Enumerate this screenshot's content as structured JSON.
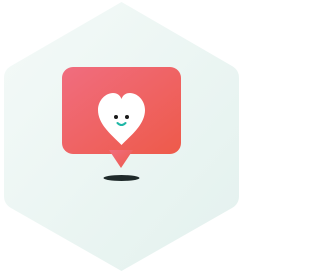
{
  "illustration": {
    "description_icon": "heart-notification-icon",
    "colors": {
      "hexagon_light": "#f4faf8",
      "hexagon_mid": "#e3f1ee",
      "bubble_top": "#f06d7f",
      "bubble_bottom": "#ee5a4a",
      "heart": "#ffffff",
      "face": "#1a1a1a",
      "smile": "#1fb7a6",
      "shadow": "#1f2a2a"
    }
  }
}
